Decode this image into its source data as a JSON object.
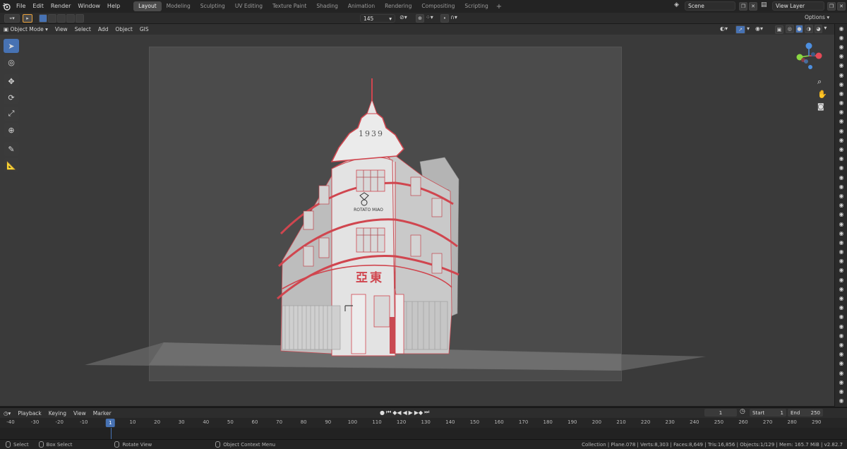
{
  "menu": [
    "File",
    "Edit",
    "Render",
    "Window",
    "Help"
  ],
  "workspaces": [
    {
      "label": "Layout",
      "active": true
    },
    {
      "label": "Modeling"
    },
    {
      "label": "Sculpting"
    },
    {
      "label": "UV Editing"
    },
    {
      "label": "Texture Paint"
    },
    {
      "label": "Shading"
    },
    {
      "label": "Animation"
    },
    {
      "label": "Rendering"
    },
    {
      "label": "Compositing"
    },
    {
      "label": "Scripting"
    }
  ],
  "scene": {
    "label": "Scene",
    "view_layer": "View Layer"
  },
  "tool_settings": {
    "value": "145",
    "options_label": "Options"
  },
  "viewport_header": {
    "mode": "Object Mode",
    "menus": [
      "View",
      "Select",
      "Add",
      "Object",
      "GIS"
    ]
  },
  "building": {
    "year": "1939",
    "sign_text": "ROTATO MIAO",
    "chinese_sign": "亞東"
  },
  "timeline": {
    "menus": [
      "Playback",
      "Keying",
      "View",
      "Marker"
    ],
    "current_frame": "1",
    "frame_display": "1",
    "start_label": "Start",
    "start_value": "1",
    "end_label": "End",
    "end_value": "250",
    "ticks": [
      "-40",
      "-30",
      "-20",
      "-10",
      "1",
      "10",
      "20",
      "30",
      "40",
      "50",
      "60",
      "70",
      "80",
      "90",
      "100",
      "110",
      "120",
      "130",
      "140",
      "150",
      "160",
      "170",
      "180",
      "190",
      "200",
      "210",
      "220",
      "230",
      "240",
      "250",
      "260",
      "270",
      "280",
      "290"
    ]
  },
  "status": {
    "select": "Select",
    "box_select": "Box Select",
    "rotate_view": "Rotate View",
    "context_menu": "Object Context Menu",
    "stats": "Collection | Plane.078 | Verts:8,303 | Faces:8,649 | Tris:16,856 | Objects:1/129 | Mem: 165.7 MiB | v2.82.7"
  },
  "icons": {
    "blender_logo": "blender-logo-icon",
    "gizmo_colors": {
      "x": "#e54a57",
      "y": "#8bd742",
      "z": "#4d8fe0"
    }
  },
  "colors": {
    "accent": "#4772b3",
    "building_trim": "#d0464f"
  }
}
